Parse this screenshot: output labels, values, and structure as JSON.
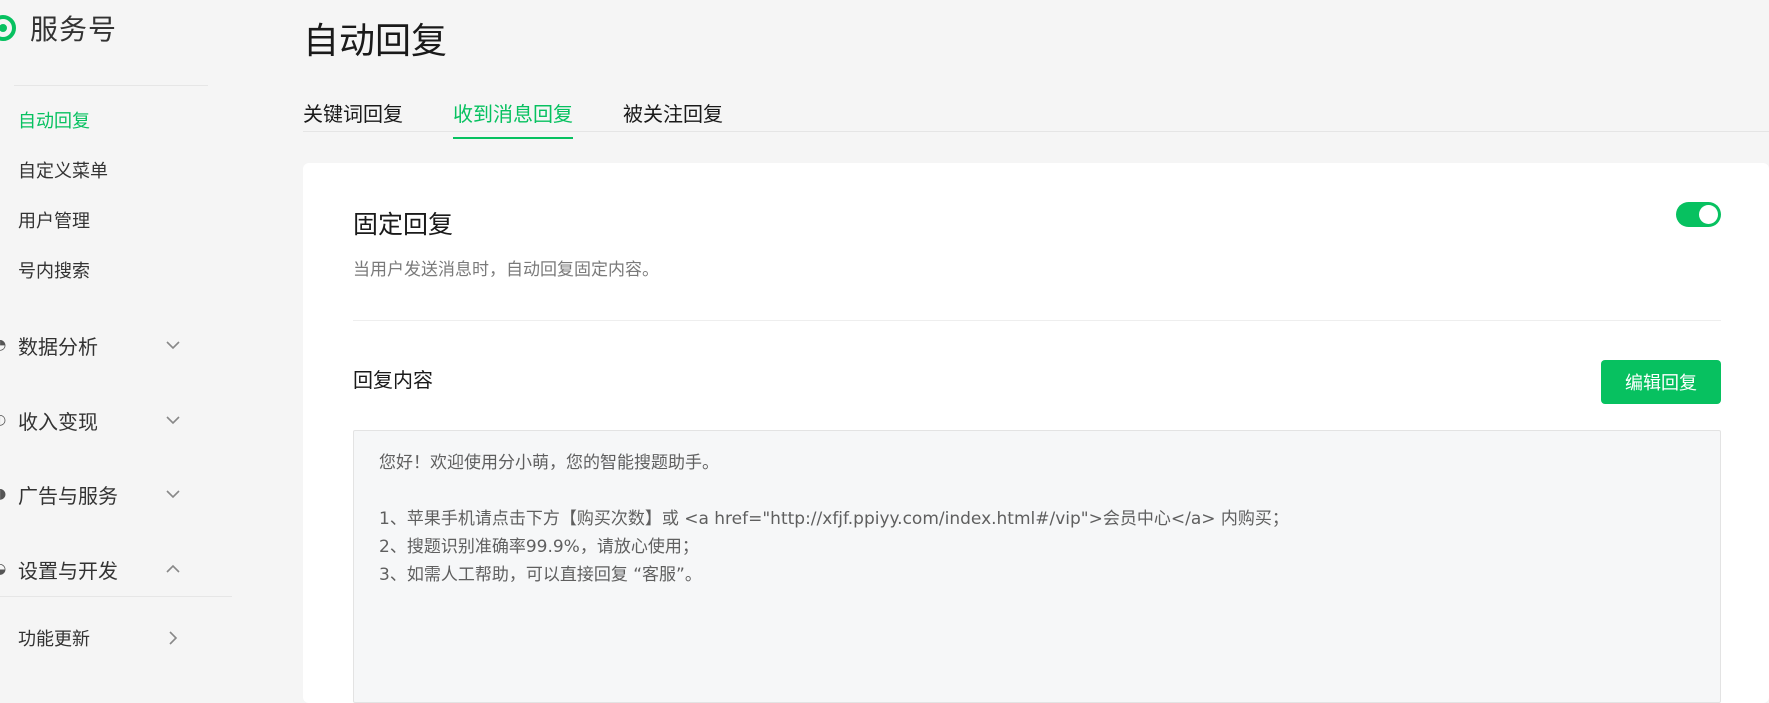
{
  "brand": {
    "name": "服务号"
  },
  "sidebar": {
    "sub_items": [
      "自动回复",
      "自定义菜单",
      "用户管理",
      "号内搜索"
    ],
    "groups": [
      {
        "label": "数据分析",
        "chevron": "down"
      },
      {
        "label": "收入变现",
        "chevron": "down"
      },
      {
        "label": "广告与服务",
        "chevron": "down"
      },
      {
        "label": "设置与开发",
        "chevron": "up"
      }
    ],
    "footer_item": {
      "label": "功能更新",
      "chevron": "right"
    }
  },
  "page": {
    "title": "自动回复"
  },
  "tabs": [
    "关键词回复",
    "收到消息回复",
    "被关注回复"
  ],
  "active_tab": "收到消息回复",
  "fixed_reply": {
    "title": "固定回复",
    "description": "当用户发送消息时，自动回复固定内容。",
    "enabled": true
  },
  "reply_content": {
    "label": "回复内容",
    "edit_button": "编辑回复",
    "lines": [
      "您好！欢迎使用分小萌，您的智能搜题助手。",
      "",
      "1、苹果手机请点击下方【购买次数】或 <a href=\"http://xfjf.ppiyy.com/index.html#/vip\">会员中心</a> 内购买；",
      "2、搜题识别准确率99.9%，请放心使用；",
      "3、如需人工帮助，可以直接回复 “客服”。"
    ]
  },
  "colors": {
    "accent": "#07c160",
    "text": "#1a1a1a",
    "muted": "#7a7a7a"
  }
}
